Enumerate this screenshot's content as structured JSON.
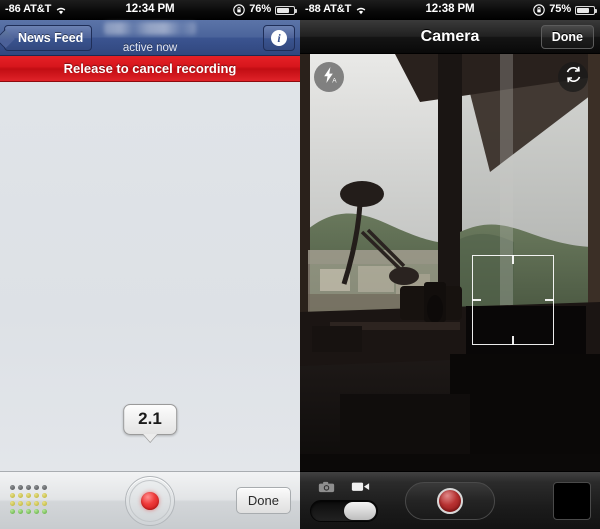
{
  "left_phone": {
    "status_bar": {
      "signal": "-86 AT&T",
      "wifi_icon": "wifi-icon",
      "time": "12:34 PM",
      "lock_icon": "rotation-lock-icon",
      "battery": "76%",
      "battery_icon": "battery-icon"
    },
    "nav": {
      "back_label": "News Feed",
      "title_redacted": "",
      "subtitle": "active now",
      "info_glyph": "i",
      "info_icon": "info-icon"
    },
    "banner": {
      "text": "Release to cancel recording"
    },
    "bubble": {
      "value": "2.1"
    },
    "toolbar": {
      "meter_icon": "audio-level-meter-icon",
      "record_icon": "record-button-icon",
      "done_label": "Done"
    }
  },
  "right_phone": {
    "status_bar": {
      "signal": "-88 AT&T",
      "wifi_icon": "wifi-icon",
      "time": "12:38 PM",
      "lock_icon": "rotation-lock-icon",
      "battery": "75%",
      "battery_icon": "battery-icon"
    },
    "nav": {
      "title": "Camera",
      "done_label": "Done"
    },
    "overlay": {
      "flash_icon": "flash-auto-icon",
      "flip_icon": "camera-flip-icon",
      "focus_icon": "focus-reticle-icon"
    },
    "toolbar": {
      "camera_mode_icon": "photo-camera-icon",
      "video_mode_icon": "video-camera-icon",
      "mode_switch_icon": "mode-toggle-switch",
      "shutter_icon": "record-shutter-icon",
      "thumbnail_icon": "last-capture-thumbnail"
    }
  },
  "colors": {
    "fb_blue": "#3b5490",
    "cancel_red": "#d7161c",
    "record_red": "#c81616",
    "body_gray": "#dfe3e7"
  }
}
